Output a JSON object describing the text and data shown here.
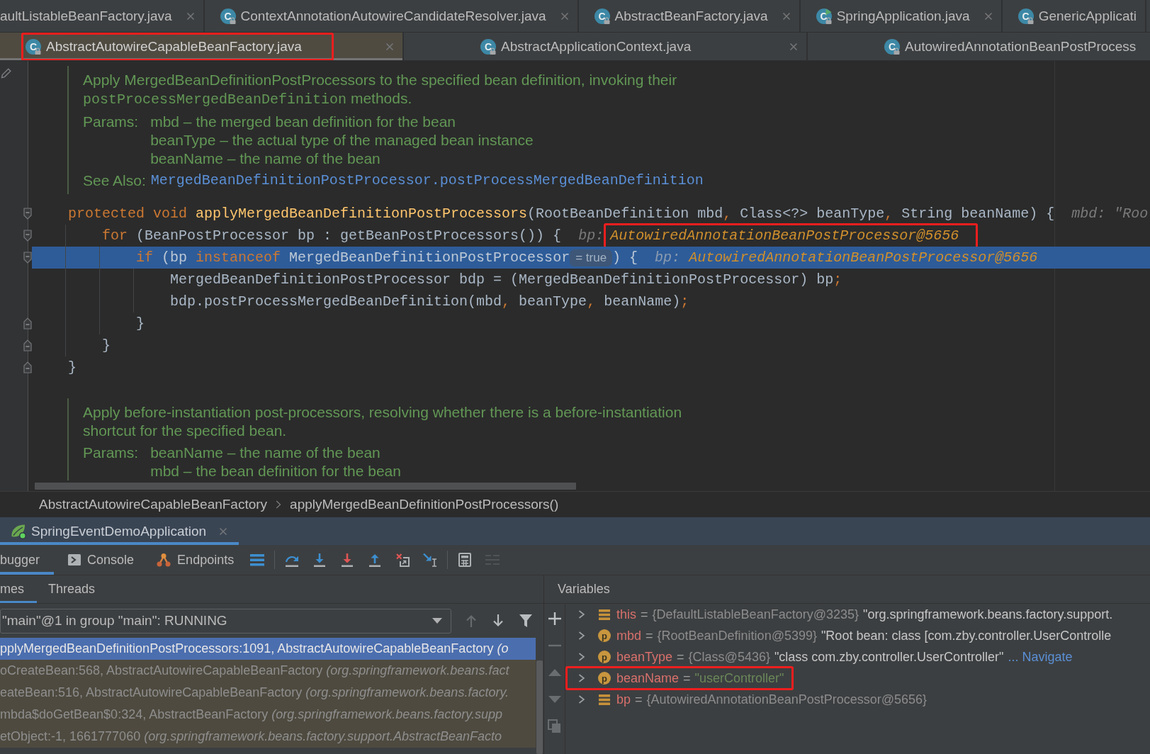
{
  "editor_tabs": {
    "rows": [
      {
        "tabs": [
          {
            "label": "aultListableBeanFactory.java",
            "closable": true,
            "selected": false,
            "highlighted": false
          },
          {
            "label": "ContextAnnotationAutowireCandidateResolver.java",
            "icon": "C",
            "read_only": true,
            "runnable": false,
            "closable": true,
            "selected": false,
            "highlighted": false
          },
          {
            "label": "AbstractBeanFactory.java",
            "icon": "C",
            "read_only": true,
            "runnable": false,
            "closable": true,
            "selected": false,
            "highlighted": false
          },
          {
            "label": "SpringApplication.java",
            "icon": "C",
            "read_only": true,
            "runnable": true,
            "closable": true,
            "selected": false,
            "highlighted": false
          },
          {
            "label": "GenericApplicati",
            "icon": "C",
            "read_only": true,
            "runnable": false,
            "closable": false,
            "selected": false,
            "highlighted": false
          }
        ]
      },
      {
        "tabs": [
          {
            "label": "AbstractAutowireCapableBeanFactory.java",
            "icon": "C",
            "read_only": true,
            "runnable": false,
            "closable": true,
            "selected": true,
            "highlighted": true
          },
          {
            "label": "AbstractApplicationContext.java",
            "icon": "C",
            "read_only": true,
            "runnable": false,
            "closable": true,
            "selected": false,
            "highlighted": false
          },
          {
            "label": "AutowiredAnnotationBeanPostProcess",
            "icon": "C",
            "read_only": true,
            "runnable": false,
            "closable": false,
            "selected": false,
            "highlighted": false
          }
        ]
      }
    ]
  },
  "editor": {
    "blocks": [
      {
        "kind": "doc",
        "render_toggle": true,
        "summary": [
          {
            "kind": "text",
            "text": "Apply MergedBeanDefinitionPostProcessors to the specified bean definition, invoking their "
          },
          {
            "kind": "code",
            "text": "postProcessMergedBeanDefinition"
          },
          {
            "kind": "text",
            "text": " methods."
          }
        ],
        "params_label": "Params:",
        "params": [
          "mbd – the merged bean definition for the bean",
          "beanType – the actual type of the managed bean instance",
          "beanName – the name of the bean"
        ],
        "see_also_label": "See Also:",
        "see_also": "MergedBeanDefinitionPostProcessor.postProcessMergedBeanDefinition"
      },
      {
        "kind": "code",
        "lines": [
          {
            "fold_start": true,
            "fold_end": false,
            "current": false,
            "segments": [
              {
                "kind": "keyword",
                "text": "protected void "
              },
              {
                "kind": "method",
                "text": "applyMergedBeanDefinitionPostProcessors"
              },
              {
                "kind": "plain",
                "text": "(RootBeanDefinition mbd"
              },
              {
                "kind": "punct",
                "text": ","
              },
              {
                "kind": "plain",
                "text": " Class<?> beanType"
              },
              {
                "kind": "punct",
                "text": ","
              },
              {
                "kind": "plain",
                "text": " String beanName) {"
              },
              {
                "kind": "hint_name",
                "text": "mbd:"
              },
              {
                "kind": "hint_text",
                "text": "\"Roo"
              }
            ],
            "children": [
              {
                "fold_start": true,
                "fold_end": false,
                "current": false,
                "segments": [
                  {
                    "kind": "keyword",
                    "text": "for"
                  },
                  {
                    "kind": "plain",
                    "text": " (BeanPostProcessor bp : getBeanPostProcessors()) {"
                  },
                  {
                    "kind": "hint_name",
                    "text": "bp:"
                  },
                  {
                    "kind": "hint_value",
                    "text": "AutowiredAnnotationBeanPostProcessor@5656",
                    "highlighted": true
                  }
                ],
                "children": [
                  {
                    "fold_start": true,
                    "fold_end": false,
                    "current": true,
                    "segments": [
                      {
                        "kind": "keyword",
                        "text": "if"
                      },
                      {
                        "kind": "plain",
                        "text": " (bp "
                      },
                      {
                        "kind": "keyword",
                        "text": "instanceof"
                      },
                      {
                        "kind": "plain",
                        "text": " MergedBeanDefinitionPostProcessor"
                      },
                      {
                        "kind": "badge",
                        "text": "= true"
                      },
                      {
                        "kind": "plain",
                        "text": ") {"
                      },
                      {
                        "kind": "hint_name",
                        "text": "bp:"
                      },
                      {
                        "kind": "hint_value",
                        "text": "AutowiredAnnotationBeanPostProcessor@5656",
                        "highlighted": false
                      }
                    ],
                    "children": [
                      {
                        "fold_start": false,
                        "fold_end": false,
                        "current": false,
                        "segments": [
                          {
                            "kind": "plain",
                            "text": "MergedBeanDefinitionPostProcessor bdp = (MergedBeanDefinitionPostProcessor) bp"
                          },
                          {
                            "kind": "punct",
                            "text": ";"
                          }
                        ]
                      },
                      {
                        "fold_start": false,
                        "fold_end": false,
                        "current": false,
                        "segments": [
                          {
                            "kind": "plain",
                            "text": "bdp.postProcessMergedBeanDefinition(mbd"
                          },
                          {
                            "kind": "punct",
                            "text": ","
                          },
                          {
                            "kind": "plain",
                            "text": " beanType"
                          },
                          {
                            "kind": "punct",
                            "text": ","
                          },
                          {
                            "kind": "plain",
                            "text": " beanName)"
                          },
                          {
                            "kind": "punct",
                            "text": ";"
                          }
                        ]
                      }
                    ]
                  },
                  {
                    "fold_start": false,
                    "fold_end": true,
                    "current": false,
                    "segments": [
                      {
                        "kind": "plain",
                        "text": "}"
                      }
                    ]
                  }
                ]
              },
              {
                "fold_start": false,
                "fold_end": true,
                "current": false,
                "segments": [
                  {
                    "kind": "plain",
                    "text": "}"
                  }
                ]
              }
            ]
          },
          {
            "fold_start": false,
            "fold_end": true,
            "current": false,
            "segments": [
              {
                "kind": "plain",
                "text": "}"
              }
            ]
          }
        ]
      },
      {
        "kind": "doc",
        "render_toggle": false,
        "summary": [
          {
            "kind": "text",
            "text": "Apply before-instantiation post-processors, resolving whether there is a before-instantiation shortcut for the specified bean."
          }
        ],
        "params_label": "Params:",
        "params": [
          "beanName – the name of the bean",
          "mbd – the bean definition for the bean"
        ]
      }
    ]
  },
  "breadcrumbs": [
    {
      "label": "AbstractAutowireCapableBeanFactory"
    },
    {
      "label": "applyMergedBeanDefinitionPostProcessors()"
    }
  ],
  "run_tabs": [
    {
      "label": "SpringEventDemoApplication",
      "selected": true
    }
  ],
  "debugger": {
    "tabs": [
      {
        "label": "bugger",
        "kind": "plain",
        "selected": true
      },
      {
        "label": "Console",
        "kind": "console",
        "selected": false
      },
      {
        "label": "Endpoints",
        "kind": "endpoints",
        "selected": false
      }
    ],
    "actions": [
      {
        "kind": "frames-menu",
        "disabled": false
      },
      {
        "kind": "separator"
      },
      {
        "kind": "step-over",
        "disabled": false
      },
      {
        "kind": "step-into",
        "disabled": false
      },
      {
        "kind": "force-step-into",
        "disabled": false
      },
      {
        "kind": "step-out",
        "disabled": false
      },
      {
        "kind": "drop-frame",
        "disabled": false
      },
      {
        "kind": "run-to-cursor",
        "disabled": false
      },
      {
        "kind": "separator"
      },
      {
        "kind": "evaluate",
        "disabled": false
      },
      {
        "kind": "trace",
        "disabled": true
      }
    ]
  },
  "frames_panel": {
    "tabs": [
      {
        "label": "mes",
        "selected": true
      },
      {
        "label": "Threads",
        "selected": false
      }
    ],
    "thread": "\"main\"@1 in group \"main\": RUNNING",
    "nav": [
      {
        "kind": "up",
        "disabled": true
      },
      {
        "kind": "down",
        "disabled": false
      },
      {
        "kind": "filter",
        "disabled": false
      }
    ],
    "frames": [
      {
        "method": "pplyMergedBeanDefinitionPostProcessors:1091, AbstractAutowireCapableBeanFactory",
        "location": "(o",
        "selected": true,
        "library": false
      },
      {
        "method": "oCreateBean:568, AbstractAutowireCapableBeanFactory",
        "location": "(org.springframework.beans.fact",
        "selected": false,
        "library": true
      },
      {
        "method": "eateBean:516, AbstractAutowireCapableBeanFactory",
        "location": "(org.springframework.beans.factory.",
        "selected": false,
        "library": true
      },
      {
        "method": "mbda$doGetBean$0:324, AbstractBeanFactory",
        "location": "(org.springframework.beans.factory.supp",
        "selected": false,
        "library": true
      },
      {
        "method": "etObject:-1, 1661777060",
        "location": "(org.springframework.beans.factory.support.AbstractBeanFacto",
        "selected": false,
        "library": true
      }
    ]
  },
  "variables_panel": {
    "title": "Variables",
    "tools": [
      {
        "kind": "add",
        "disabled": false
      },
      {
        "kind": "remove",
        "disabled": true
      },
      {
        "kind": "up",
        "disabled": true
      },
      {
        "kind": "down",
        "disabled": true
      },
      {
        "kind": "copy",
        "disabled": true
      }
    ],
    "variables": [
      {
        "name": "this",
        "kind": "field",
        "operator": "=",
        "expanded": false,
        "highlighted": false,
        "value": [
          {
            "kind": "ref",
            "text": "{DefaultListableBeanFactory@3235}"
          },
          {
            "kind": "text",
            "text": "\"org.springframework.beans.factory.support."
          }
        ]
      },
      {
        "name": "mbd",
        "kind": "parameter",
        "icon_letter": "p",
        "operator": "=",
        "expanded": false,
        "highlighted": false,
        "value": [
          {
            "kind": "ref",
            "text": "{RootBeanDefinition@5399}"
          },
          {
            "kind": "text",
            "text": "\"Root bean: class [com.zby.controller.UserControlle"
          }
        ]
      },
      {
        "name": "beanType",
        "kind": "parameter",
        "icon_letter": "p",
        "operator": "=",
        "expanded": false,
        "highlighted": false,
        "value": [
          {
            "kind": "ref",
            "text": "{Class@5436}"
          },
          {
            "kind": "text",
            "text": "\"class com.zby.controller.UserController\""
          },
          {
            "kind": "link",
            "text": "... Navigate"
          }
        ]
      },
      {
        "name": "beanName",
        "kind": "parameter",
        "icon_letter": "p",
        "operator": "=",
        "expanded": false,
        "highlighted": true,
        "value": [
          {
            "kind": "string",
            "text": "\"userController\""
          }
        ]
      },
      {
        "name": "bp",
        "kind": "field",
        "operator": "=",
        "expanded": false,
        "highlighted": false,
        "value": [
          {
            "kind": "ref",
            "text": "{AutowiredAnnotationBeanPostProcessor@5656}"
          }
        ]
      }
    ]
  }
}
